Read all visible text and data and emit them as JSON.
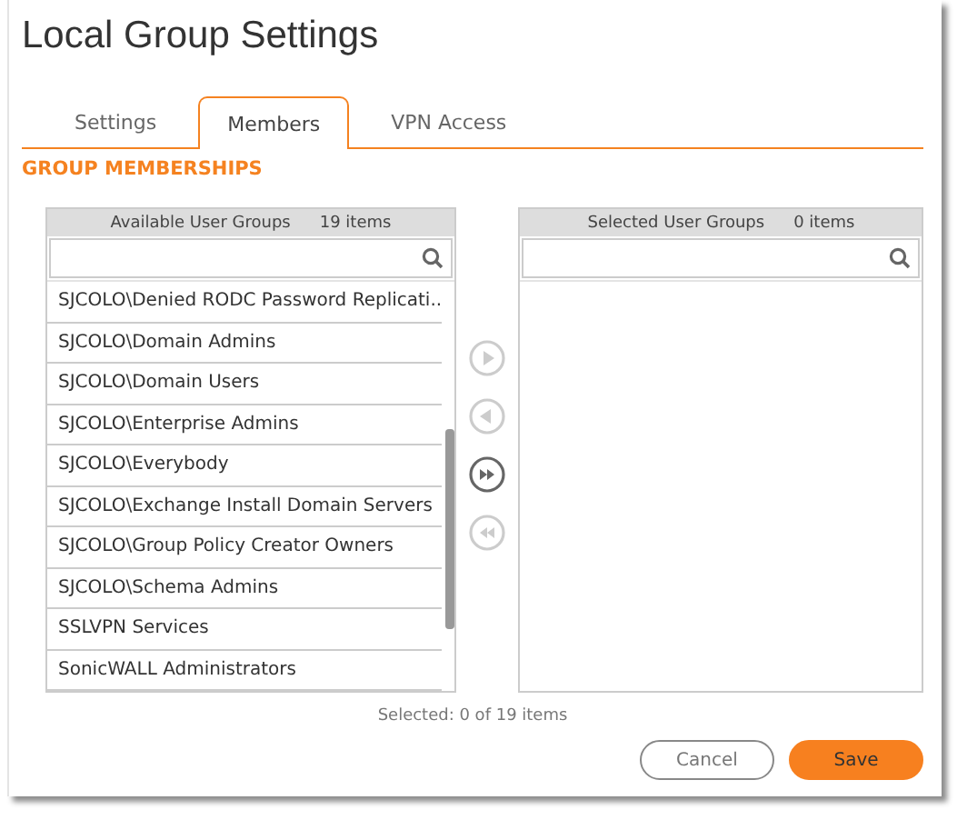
{
  "window": {
    "title": "Local Group Settings"
  },
  "tabs": [
    {
      "label": "Settings",
      "selected": false
    },
    {
      "label": "Members",
      "selected": true
    },
    {
      "label": "VPN Access",
      "selected": false
    }
  ],
  "section_heading": "GROUP MEMBERSHIPS",
  "available": {
    "title": "Available User Groups",
    "count": "19 items",
    "items": [
      "SJCOLO\\Denied RODC Password Replicati...",
      "SJCOLO\\Domain Admins",
      "SJCOLO\\Domain Users",
      "SJCOLO\\Enterprise Admins",
      "SJCOLO\\Everybody",
      "SJCOLO\\Exchange Install Domain Servers",
      "SJCOLO\\Group Policy Creator Owners",
      "SJCOLO\\Schema Admins",
      "SSLVPN Services",
      "SonicWALL Administrators"
    ]
  },
  "move_buttons": [
    {
      "kind": "right",
      "disabled": true
    },
    {
      "kind": "left",
      "disabled": true
    },
    {
      "kind": "all-right",
      "disabled": false
    },
    {
      "kind": "all-left",
      "disabled": true
    }
  ],
  "selected": {
    "title": "Selected User Groups",
    "count": "0 items"
  },
  "selection_status": "Selected: 0 of 19 items",
  "buttons": [
    {
      "label": "Cancel",
      "kind": "secondary"
    },
    {
      "label": "Save",
      "kind": "primary"
    }
  ]
}
